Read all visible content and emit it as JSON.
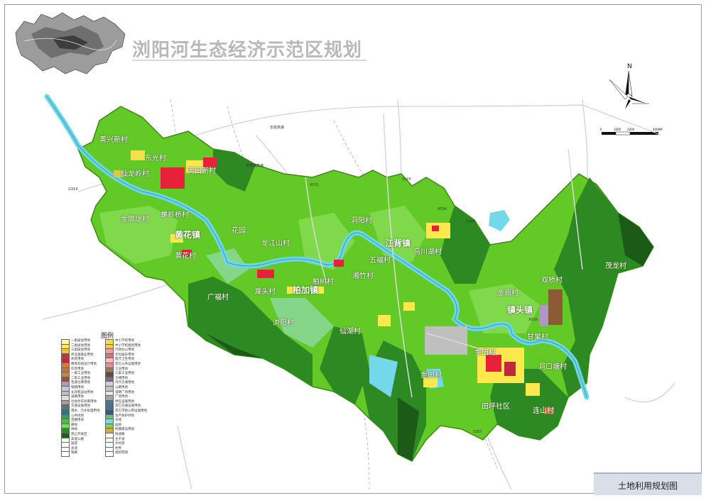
{
  "header": {
    "title": "浏阳河生态经济示范区规划"
  },
  "compass": {
    "north_label": "N"
  },
  "scale": {
    "ticks": [
      "0",
      "1000",
      "2000",
      "4000M"
    ]
  },
  "map_name": "土地利用规划图",
  "legend": {
    "title": "图例",
    "items": [
      {
        "label": "一类居住用地",
        "color": "#fff7a8"
      },
      {
        "label": "二类居住用地",
        "color": "#ffe84d"
      },
      {
        "label": "三类居住用地",
        "color": "#d9c84a"
      },
      {
        "label": "商业金融业用地",
        "color": "#e8213a"
      },
      {
        "label": "体育用地",
        "color": "#c1273d"
      },
      {
        "label": "教育科研设计用地",
        "color": "#d67a2c"
      },
      {
        "label": "综合用地",
        "color": "#e06a2b"
      },
      {
        "label": "一类工业用地",
        "color": "#b78a5a"
      },
      {
        "label": "二类工业用地",
        "color": "#8c5a34"
      },
      {
        "label": "普通仓库用地",
        "color": "#b095c7"
      },
      {
        "label": "铁路用地",
        "color": "#c8c8c8"
      },
      {
        "label": "长途客运站用地",
        "color": "#bcbcbc"
      },
      {
        "label": "道路用地",
        "color": "#dedede"
      },
      {
        "label": "社会停车场库用地",
        "color": "#a0a0a0"
      },
      {
        "label": "交通设施用地",
        "color": "#6e6e6e"
      },
      {
        "label": "雨水、污水处理用地",
        "color": "#1f7a8c"
      },
      {
        "label": "公共绿地",
        "color": "#34a653"
      },
      {
        "label": "苗圃用地",
        "color": "#52b848"
      },
      {
        "label": "耕地",
        "color": "#7ed957"
      },
      {
        "label": "林地",
        "color": "#2e8b2e"
      },
      {
        "label": "禁止开发区",
        "color": "#1f5e1f"
      },
      {
        "label": "高速公路",
        "color": "#ffffff"
      },
      {
        "label": "国道",
        "color": "#ffffff"
      },
      {
        "label": "县道",
        "color": "#ffffff"
      },
      {
        "label": "铁路",
        "color": "#ffffff"
      },
      {
        "label": "中小学校用地",
        "color": "#f4e04d"
      },
      {
        "label": "中小学校规划用地",
        "color": "#e9cf3a"
      },
      {
        "label": "行政办公用地",
        "color": "#f09bb5"
      },
      {
        "label": "文化娱乐用地",
        "color": "#e86d6d"
      },
      {
        "label": "医疗卫生用地",
        "color": "#f7c2c2"
      },
      {
        "label": "其它公共设施用地",
        "color": "#ed8aa0"
      },
      {
        "label": "工业用地",
        "color": "#a07a55"
      },
      {
        "label": "三类工业用地",
        "color": "#6b4a2e"
      },
      {
        "label": "仓储用地",
        "color": "#7d6999"
      },
      {
        "label": "对外交通用地",
        "color": "#d0d0d0"
      },
      {
        "label": "公路用地",
        "color": "#c4c4c4"
      },
      {
        "label": "道路广场用地",
        "color": "#e6e6e6"
      },
      {
        "label": "广场用地",
        "color": "#9aa8a8"
      },
      {
        "label": "供应设施用地",
        "color": "#3c7c9a"
      },
      {
        "label": "其它交通设施用地",
        "color": "#4f6f8a"
      },
      {
        "label": "其它市政公用设施用地",
        "color": "#2b5f7a"
      },
      {
        "label": "生产防护绿地",
        "color": "#60c47a"
      },
      {
        "label": "水域",
        "color": "#7fd6e8"
      },
      {
        "label": "园地",
        "color": "#8fce4a"
      },
      {
        "label": "村镇建设用地",
        "color": "#d4a84e"
      },
      {
        "label": "快速路",
        "color": "#ffffff"
      },
      {
        "label": "主干道",
        "color": "#ffffff"
      },
      {
        "label": "乡村道",
        "color": "#ffffff"
      },
      {
        "label": "村界",
        "color": "#ffffff"
      },
      {
        "label": "规划范围",
        "color": "#ffffff"
      }
    ]
  },
  "places": [
    {
      "name": "黄兴新村",
      "kind": "village"
    },
    {
      "name": "东光村",
      "kind": "village"
    },
    {
      "name": "仙龙岭村",
      "kind": "village"
    },
    {
      "name": "黄田新村",
      "kind": "village"
    },
    {
      "name": "金屏垅村",
      "kind": "village"
    },
    {
      "name": "螺岭桥村",
      "kind": "village"
    },
    {
      "name": "黄花镇",
      "kind": "town"
    },
    {
      "name": "黄花村",
      "kind": "village"
    },
    {
      "name": "花园",
      "kind": "village"
    },
    {
      "name": "龙江山村",
      "kind": "village"
    },
    {
      "name": "洞阳村",
      "kind": "village"
    },
    {
      "name": "江背镇",
      "kind": "town"
    },
    {
      "name": "乌川湖村",
      "kind": "village"
    },
    {
      "name": "五福村",
      "kind": "village"
    },
    {
      "name": "湘竹村",
      "kind": "village"
    },
    {
      "name": "柏树村",
      "kind": "village"
    },
    {
      "name": "广福村",
      "kind": "village"
    },
    {
      "name": "渡头村",
      "kind": "village"
    },
    {
      "name": "柏加镇",
      "kind": "town"
    },
    {
      "name": "仙湖村",
      "kind": "village"
    },
    {
      "name": "金鼎村",
      "kind": "village"
    },
    {
      "name": "浏阳村",
      "kind": "village"
    },
    {
      "name": "镇头镇",
      "kind": "town"
    },
    {
      "name": "双桥村",
      "kind": "village"
    },
    {
      "name": "金田村",
      "kind": "village"
    },
    {
      "name": "甘棠村",
      "kind": "village"
    },
    {
      "name": "洞口塘村",
      "kind": "village"
    },
    {
      "name": "金田村",
      "kind": "village"
    },
    {
      "name": "田坪社区",
      "kind": "village"
    },
    {
      "name": "连山村",
      "kind": "village"
    },
    {
      "name": "茂龙村",
      "kind": "village"
    }
  ],
  "roads": [
    "长张高速",
    "浏阳河",
    "X031",
    "X034",
    "S103",
    "S309",
    "京港澳高速",
    "X036",
    "S207",
    "G319"
  ]
}
